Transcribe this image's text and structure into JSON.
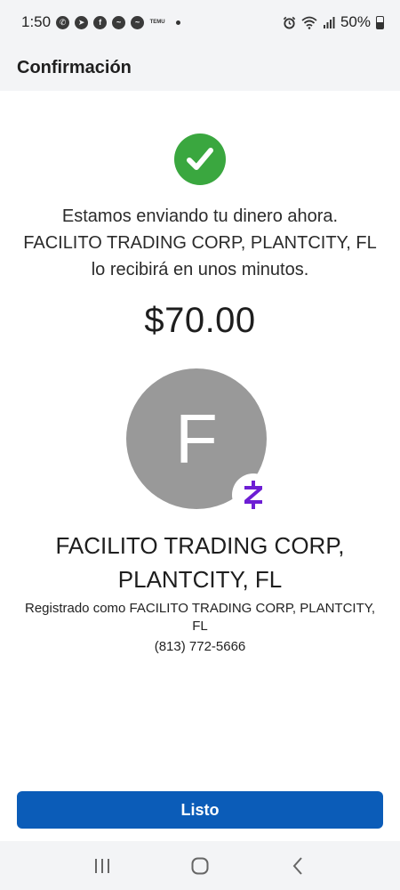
{
  "status_bar": {
    "time": "1:50",
    "battery_percent": "50%",
    "temu_label": "TEMU",
    "app_icons": [
      "whatsapp-icon",
      "telegram-icon",
      "facebook-icon",
      "messenger-icon",
      "messenger-icon",
      "temu-icon"
    ]
  },
  "header": {
    "title": "Confirmación"
  },
  "confirmation": {
    "status_icon": "check-circle-icon",
    "message_lines": [
      "Estamos enviando tu dinero ahora.",
      "FACILITO TRADING CORP, PLANTCITY, FL",
      "lo recibirá en unos minutos."
    ],
    "amount": "$70.00"
  },
  "recipient": {
    "avatar_initial": "F",
    "badge_icon": "zelle-icon",
    "name_lines": [
      "FACILITO TRADING CORP,",
      "PLANTCITY, FL"
    ],
    "registered_lines": [
      "Registrado como FACILITO TRADING CORP, PLANTCITY,",
      "FL"
    ],
    "phone": "(813) 772-5666"
  },
  "actions": {
    "done_label": "Listo"
  },
  "colors": {
    "success": "#3aa73f",
    "primary": "#0b5cb8",
    "avatar": "#999999",
    "zelle": "#6d1ed4"
  }
}
